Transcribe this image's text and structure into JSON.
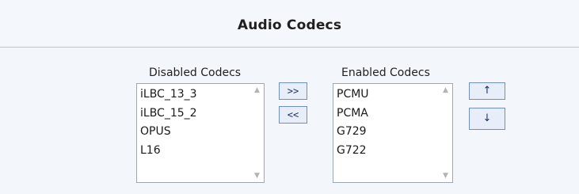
{
  "header": {
    "title": "Audio Codecs"
  },
  "disabled": {
    "label": "Disabled Codecs",
    "items": [
      "iLBC_13_3",
      "iLBC_15_2",
      "OPUS",
      "L16"
    ]
  },
  "enabled": {
    "label": "Enabled Codecs",
    "items": [
      "PCMU",
      "PCMA",
      "G729",
      "G722"
    ]
  },
  "buttons": {
    "enable": ">>",
    "disable": "<<",
    "move_up": "↑",
    "move_down": "↓"
  },
  "scroll": {
    "up": "▲",
    "down": "▼"
  },
  "colors": {
    "header_border": "#b6c6de",
    "button_bg": "#e7eef9",
    "button_border": "#6e8fc4"
  }
}
